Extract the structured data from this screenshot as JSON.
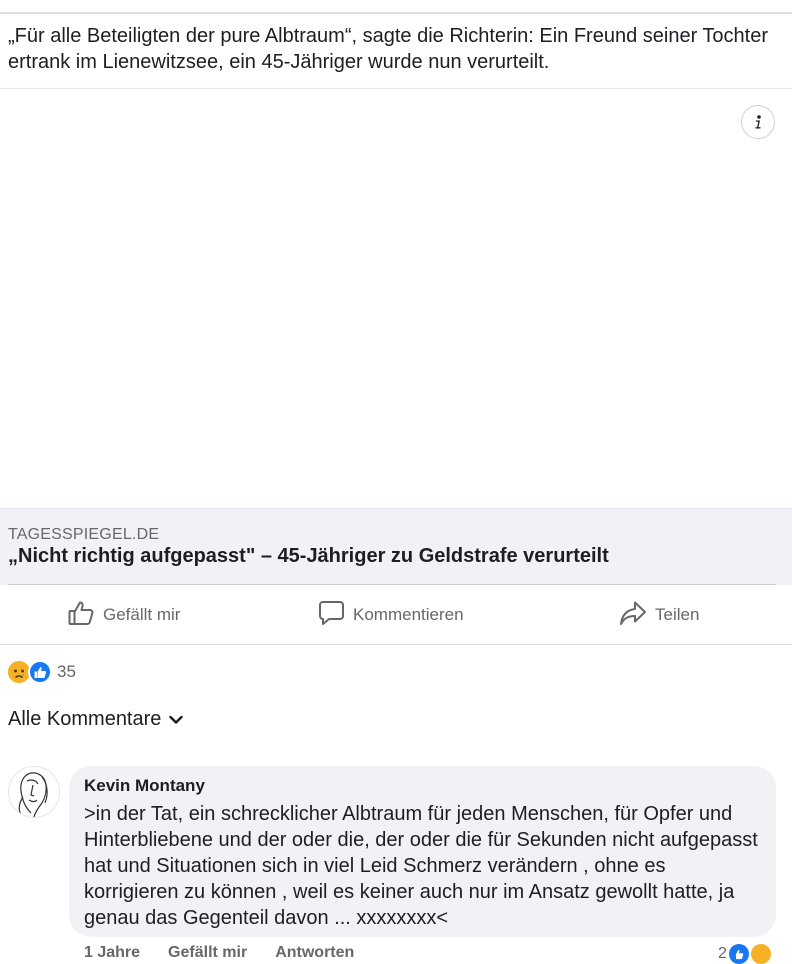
{
  "post": {
    "text": "„Für alle Beteiligten der pure Albtraum“, sagte die Richterin: Ein Freund seiner Tochter ertrank im Lienewitzsee, ein 45-Jähriger wurde nun verurteilt.",
    "info_icon": "info-icon"
  },
  "link_preview": {
    "domain": "TAGESSPIEGEL.DE",
    "title": "„Nicht richtig aufgepasst\" – 45-Jähriger zu Geldstrafe verurteilt"
  },
  "actions": {
    "like_label": "Gefällt mir",
    "comment_label": "Kommentieren",
    "share_label": "Teilen"
  },
  "reactions": {
    "icons": [
      "sad-reaction-icon",
      "like-reaction-icon"
    ],
    "count": "35"
  },
  "comments_filter": {
    "label": "Alle Kommentare",
    "icon": "chevron-down-icon"
  },
  "comment": {
    "author": "Kevin Montany",
    "text": ">in der Tat, ein schrecklicher Albtraum für jeden Menschen, für Opfer und Hinterbliebene und der oder die, der oder die für Sekunden nicht aufgepasst hat und Situationen sich in viel Leid Schmerz verändern , ohne es korrigieren zu können , weil es keiner auch nur im Ansatz gewollt hatte, ja genau das Gegenteil davon ... xxxxxxxx<",
    "time": "1 Jahre",
    "like_label": "Gefällt mir",
    "reply_label": "Antworten",
    "reaction_count": "2"
  },
  "colors": {
    "like_blue": "#1877f2",
    "sad_yellow": "#f7b125",
    "secondary_text": "#65676b",
    "card_bg": "#f0f2f5"
  }
}
